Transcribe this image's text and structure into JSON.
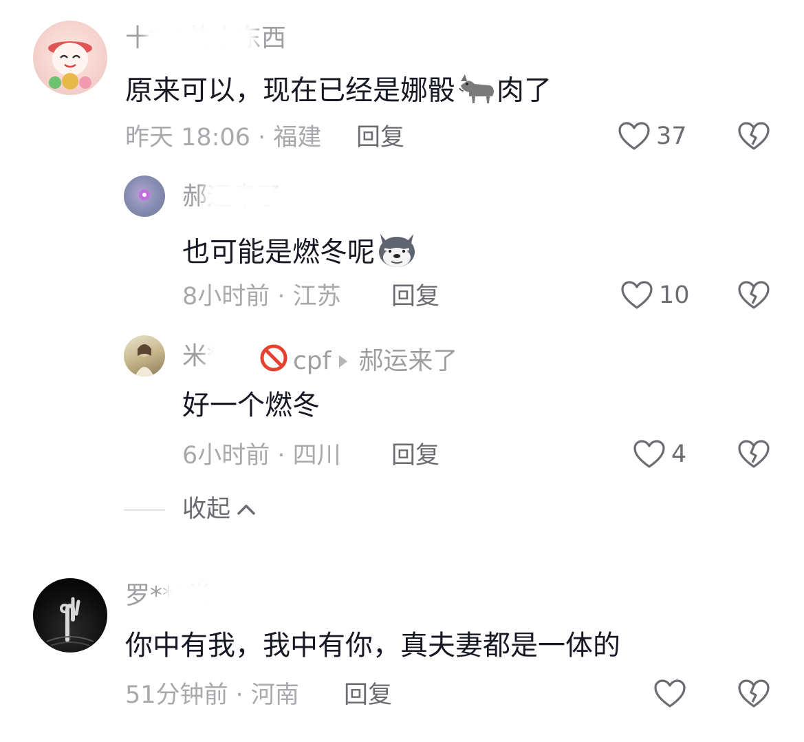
{
  "comments": [
    {
      "username": "十***的小东西",
      "text_before_emoji": "原来可以，现在已经是娜骰",
      "emoji": "donkey-emoji",
      "text_after_emoji": "肉了",
      "time_location": "昨天 18:06 · 福建",
      "reply_label": "回复",
      "likes": "37"
    },
    {
      "username": "郝运来了",
      "text": "也可能是燃冬呢",
      "emoji": "wolf-emoji",
      "time_location": "8小时前 · 江苏",
      "reply_label": "回复",
      "likes": "10"
    },
    {
      "username": "米***",
      "reply_to_prefix": "cpf",
      "reply_target": "郝运来了",
      "text": "好一个燃冬",
      "time_location": "6小时前 · 四川",
      "reply_label": "回复",
      "likes": "4"
    },
    {
      "username": "罗***觉",
      "text": "你中有我，我中有你，真夫妻都是一体的",
      "time_location": "51分钟前 · 河南",
      "reply_label": "回复",
      "likes": ""
    }
  ],
  "collapse_label": "收起",
  "colors": {
    "text": "#161823",
    "meta": "#a8a8ad",
    "action": "#6b6b72"
  }
}
